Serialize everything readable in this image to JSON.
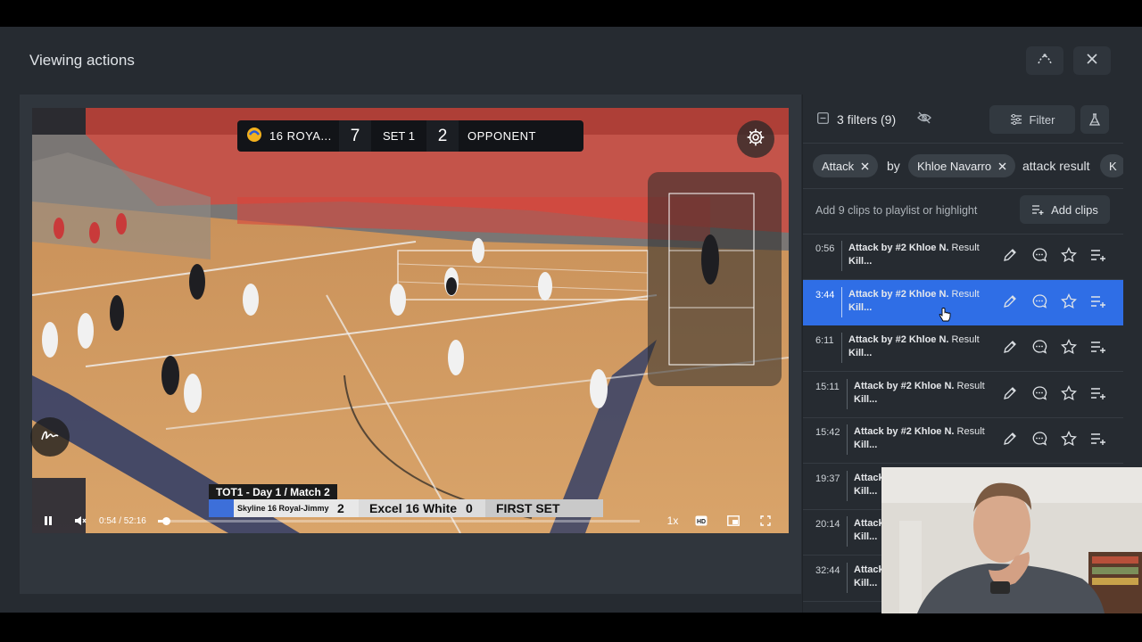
{
  "modal": {
    "title": "Viewing actions",
    "header_icons": [
      "timeline-icon",
      "close-icon"
    ]
  },
  "video": {
    "scorebar": {
      "team1": "16 ROYA...",
      "score1": "7",
      "set": "SET 1",
      "score2": "2",
      "team2": "OPPONENT"
    },
    "broadcast_overlay": {
      "event": "TOT1 - Day 1 / Match 2",
      "team1": "Skyline 16 Royal-Jimmy",
      "score1": "2",
      "team2": "Excel 16 White",
      "score2": "0",
      "set_label": "FIRST SET"
    },
    "controls": {
      "time": "0:54 / 52:16",
      "progress": 0.017,
      "speed": "1x"
    }
  },
  "panel": {
    "filters_label": "3 filters (9)",
    "filter_button": "Filter",
    "chips": {
      "chip1": "Attack",
      "by": "by",
      "chip2": "Khloe Navarro",
      "text3": "attack result",
      "chip4": "K"
    },
    "add_clips_label": "Add 9 clips to playlist or highlight",
    "add_clips_button": "Add clips",
    "clips": [
      {
        "time": "0:56",
        "title": "Attack",
        "rest": " by #2 Khloe N.",
        "tail": " Result",
        "line2": "Kill..."
      },
      {
        "time": "3:44",
        "title": "Attack",
        "rest": " by #2 Khloe N.",
        "tail": " Result",
        "line2": "Kill..."
      },
      {
        "time": "6:11",
        "title": "Attack",
        "rest": " by #2 Khloe N.",
        "tail": " Result",
        "line2": "Kill..."
      },
      {
        "time": "15:11",
        "title": "Attack",
        "rest": " by #2 Khloe N.",
        "tail": " Result",
        "line2": "Kill..."
      },
      {
        "time": "15:42",
        "title": "Attack",
        "rest": " by #2 Khloe N.",
        "tail": " Result",
        "line2": "Kill..."
      },
      {
        "time": "19:37",
        "title": "Attack",
        "rest": "",
        "tail": "",
        "line2": "Kill..."
      },
      {
        "time": "20:14",
        "title": "Attack",
        "rest": "",
        "tail": "",
        "line2": "Kill..."
      },
      {
        "time": "32:44",
        "title": "Attack",
        "rest": "",
        "tail": "",
        "line2": "Kill..."
      }
    ]
  },
  "colors": {
    "accent": "#2f6ee6",
    "modal_bg": "#262b31",
    "red_overlay": "#e0463a"
  }
}
